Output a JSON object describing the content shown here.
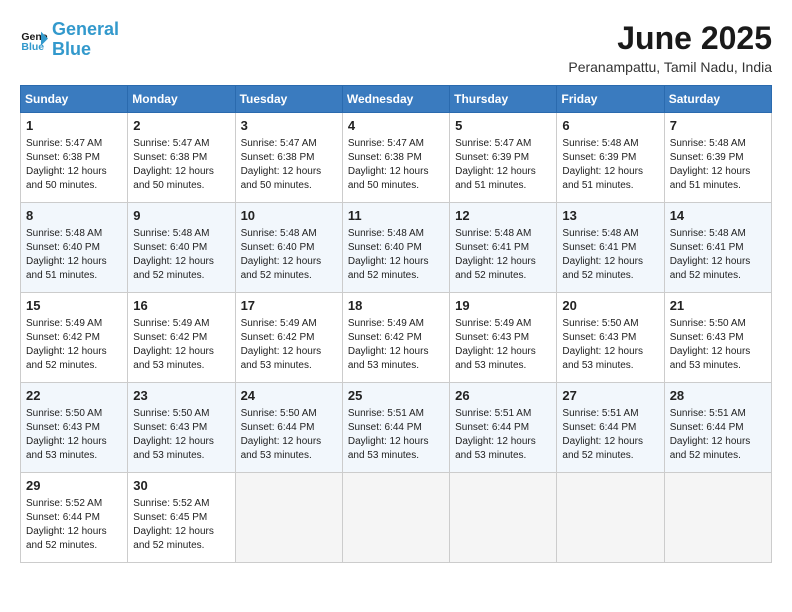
{
  "header": {
    "logo_line1": "General",
    "logo_line2": "Blue",
    "title": "June 2025",
    "subtitle": "Peranampattu, Tamil Nadu, India"
  },
  "weekdays": [
    "Sunday",
    "Monday",
    "Tuesday",
    "Wednesday",
    "Thursday",
    "Friday",
    "Saturday"
  ],
  "weeks": [
    [
      {
        "day": "1",
        "info": "Sunrise: 5:47 AM\nSunset: 6:38 PM\nDaylight: 12 hours\nand 50 minutes."
      },
      {
        "day": "2",
        "info": "Sunrise: 5:47 AM\nSunset: 6:38 PM\nDaylight: 12 hours\nand 50 minutes."
      },
      {
        "day": "3",
        "info": "Sunrise: 5:47 AM\nSunset: 6:38 PM\nDaylight: 12 hours\nand 50 minutes."
      },
      {
        "day": "4",
        "info": "Sunrise: 5:47 AM\nSunset: 6:38 PM\nDaylight: 12 hours\nand 50 minutes."
      },
      {
        "day": "5",
        "info": "Sunrise: 5:47 AM\nSunset: 6:39 PM\nDaylight: 12 hours\nand 51 minutes."
      },
      {
        "day": "6",
        "info": "Sunrise: 5:48 AM\nSunset: 6:39 PM\nDaylight: 12 hours\nand 51 minutes."
      },
      {
        "day": "7",
        "info": "Sunrise: 5:48 AM\nSunset: 6:39 PM\nDaylight: 12 hours\nand 51 minutes."
      }
    ],
    [
      {
        "day": "8",
        "info": "Sunrise: 5:48 AM\nSunset: 6:40 PM\nDaylight: 12 hours\nand 51 minutes."
      },
      {
        "day": "9",
        "info": "Sunrise: 5:48 AM\nSunset: 6:40 PM\nDaylight: 12 hours\nand 52 minutes."
      },
      {
        "day": "10",
        "info": "Sunrise: 5:48 AM\nSunset: 6:40 PM\nDaylight: 12 hours\nand 52 minutes."
      },
      {
        "day": "11",
        "info": "Sunrise: 5:48 AM\nSunset: 6:40 PM\nDaylight: 12 hours\nand 52 minutes."
      },
      {
        "day": "12",
        "info": "Sunrise: 5:48 AM\nSunset: 6:41 PM\nDaylight: 12 hours\nand 52 minutes."
      },
      {
        "day": "13",
        "info": "Sunrise: 5:48 AM\nSunset: 6:41 PM\nDaylight: 12 hours\nand 52 minutes."
      },
      {
        "day": "14",
        "info": "Sunrise: 5:48 AM\nSunset: 6:41 PM\nDaylight: 12 hours\nand 52 minutes."
      }
    ],
    [
      {
        "day": "15",
        "info": "Sunrise: 5:49 AM\nSunset: 6:42 PM\nDaylight: 12 hours\nand 52 minutes."
      },
      {
        "day": "16",
        "info": "Sunrise: 5:49 AM\nSunset: 6:42 PM\nDaylight: 12 hours\nand 53 minutes."
      },
      {
        "day": "17",
        "info": "Sunrise: 5:49 AM\nSunset: 6:42 PM\nDaylight: 12 hours\nand 53 minutes."
      },
      {
        "day": "18",
        "info": "Sunrise: 5:49 AM\nSunset: 6:42 PM\nDaylight: 12 hours\nand 53 minutes."
      },
      {
        "day": "19",
        "info": "Sunrise: 5:49 AM\nSunset: 6:43 PM\nDaylight: 12 hours\nand 53 minutes."
      },
      {
        "day": "20",
        "info": "Sunrise: 5:50 AM\nSunset: 6:43 PM\nDaylight: 12 hours\nand 53 minutes."
      },
      {
        "day": "21",
        "info": "Sunrise: 5:50 AM\nSunset: 6:43 PM\nDaylight: 12 hours\nand 53 minutes."
      }
    ],
    [
      {
        "day": "22",
        "info": "Sunrise: 5:50 AM\nSunset: 6:43 PM\nDaylight: 12 hours\nand 53 minutes."
      },
      {
        "day": "23",
        "info": "Sunrise: 5:50 AM\nSunset: 6:43 PM\nDaylight: 12 hours\nand 53 minutes."
      },
      {
        "day": "24",
        "info": "Sunrise: 5:50 AM\nSunset: 6:44 PM\nDaylight: 12 hours\nand 53 minutes."
      },
      {
        "day": "25",
        "info": "Sunrise: 5:51 AM\nSunset: 6:44 PM\nDaylight: 12 hours\nand 53 minutes."
      },
      {
        "day": "26",
        "info": "Sunrise: 5:51 AM\nSunset: 6:44 PM\nDaylight: 12 hours\nand 53 minutes."
      },
      {
        "day": "27",
        "info": "Sunrise: 5:51 AM\nSunset: 6:44 PM\nDaylight: 12 hours\nand 52 minutes."
      },
      {
        "day": "28",
        "info": "Sunrise: 5:51 AM\nSunset: 6:44 PM\nDaylight: 12 hours\nand 52 minutes."
      }
    ],
    [
      {
        "day": "29",
        "info": "Sunrise: 5:52 AM\nSunset: 6:44 PM\nDaylight: 12 hours\nand 52 minutes."
      },
      {
        "day": "30",
        "info": "Sunrise: 5:52 AM\nSunset: 6:45 PM\nDaylight: 12 hours\nand 52 minutes."
      },
      null,
      null,
      null,
      null,
      null
    ]
  ]
}
